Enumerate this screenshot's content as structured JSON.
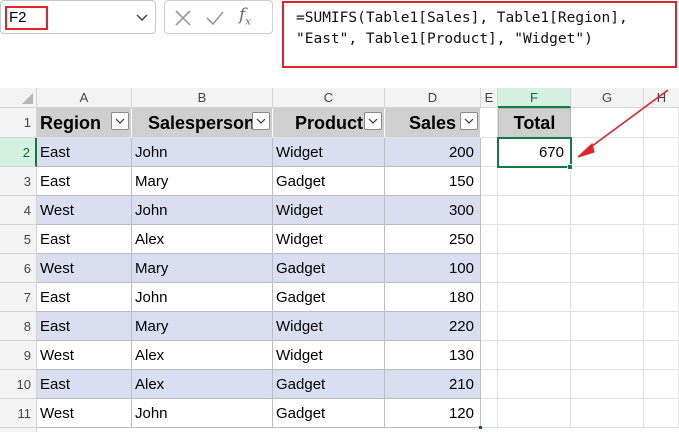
{
  "name_box": {
    "value": "F2"
  },
  "formula_bar": {
    "fx_label": "f",
    "fx_sub": "x",
    "formula_line1": "=SUMIFS(Table1[Sales], Table1[Region],",
    "formula_line2": "\"East\", Table1[Product], \"Widget\")"
  },
  "column_headers": [
    "A",
    "B",
    "C",
    "D",
    "E",
    "F",
    "G",
    "H"
  ],
  "row_headers": [
    "1",
    "2",
    "3",
    "4",
    "5",
    "6",
    "7",
    "8",
    "9",
    "10",
    "11"
  ],
  "table": {
    "headers": [
      "Region",
      "Salesperson",
      "Product",
      "Sales"
    ],
    "rows": [
      [
        "East",
        "John",
        "Widget",
        "200"
      ],
      [
        "East",
        "Mary",
        "Gadget",
        "150"
      ],
      [
        "West",
        "John",
        "Widget",
        "300"
      ],
      [
        "East",
        "Alex",
        "Widget",
        "250"
      ],
      [
        "West",
        "Mary",
        "Gadget",
        "100"
      ],
      [
        "East",
        "John",
        "Gadget",
        "180"
      ],
      [
        "East",
        "Mary",
        "Widget",
        "220"
      ],
      [
        "West",
        "Alex",
        "Widget",
        "130"
      ],
      [
        "East",
        "Alex",
        "Gadget",
        "210"
      ],
      [
        "West",
        "John",
        "Gadget",
        "120"
      ]
    ]
  },
  "total": {
    "header": "Total",
    "value": "670"
  },
  "colors": {
    "accent_green": "#107c41",
    "highlight_red": "#e0242a",
    "band_blue": "#d9def0",
    "header_gray": "#cfcfcf"
  },
  "icons": [
    "chevron-down-icon",
    "cancel-x-icon",
    "check-icon",
    "function-fx-icon",
    "filter-dropdown-icon",
    "arrow-annotation"
  ]
}
